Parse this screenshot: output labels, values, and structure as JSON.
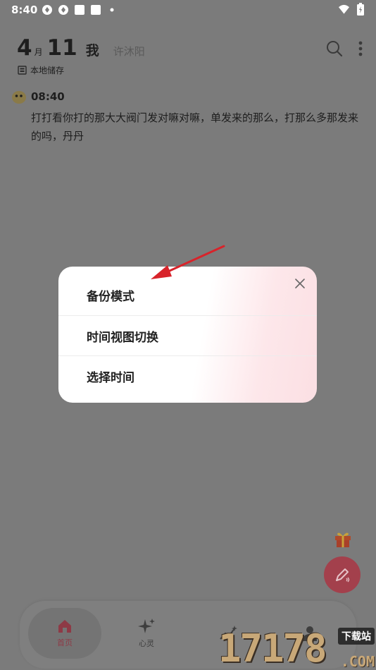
{
  "status_bar": {
    "time": "8:40"
  },
  "header": {
    "day": "4",
    "month_unit": "月",
    "month": "11",
    "me_label": "我",
    "username": "许沐阳",
    "storage_label": "本地储存"
  },
  "entry": {
    "time": "08:40",
    "text": "打打看你打的那大大阀门发对嘛对嘛，单发来的那么，打那么多那发来的吗，丹丹"
  },
  "popup": {
    "items": [
      {
        "label": "备份模式"
      },
      {
        "label": "时间视图切换"
      },
      {
        "label": "选择时间"
      }
    ]
  },
  "bottom_nav": {
    "items": [
      {
        "label": "首页",
        "icon": "home-icon",
        "active": true
      },
      {
        "label": "心灵",
        "icon": "sparkle-icon",
        "active": false
      },
      {
        "label": "",
        "icon": "chart-icon",
        "active": false
      },
      {
        "label": "",
        "icon": "person-icon",
        "active": false
      }
    ]
  },
  "watermark": {
    "text": "17178",
    "badge": "下载站",
    "suffix": ".COM"
  },
  "colors": {
    "accent": "#a3404c",
    "overlay": "#7b7b7b",
    "arrow": "#d8232a"
  }
}
